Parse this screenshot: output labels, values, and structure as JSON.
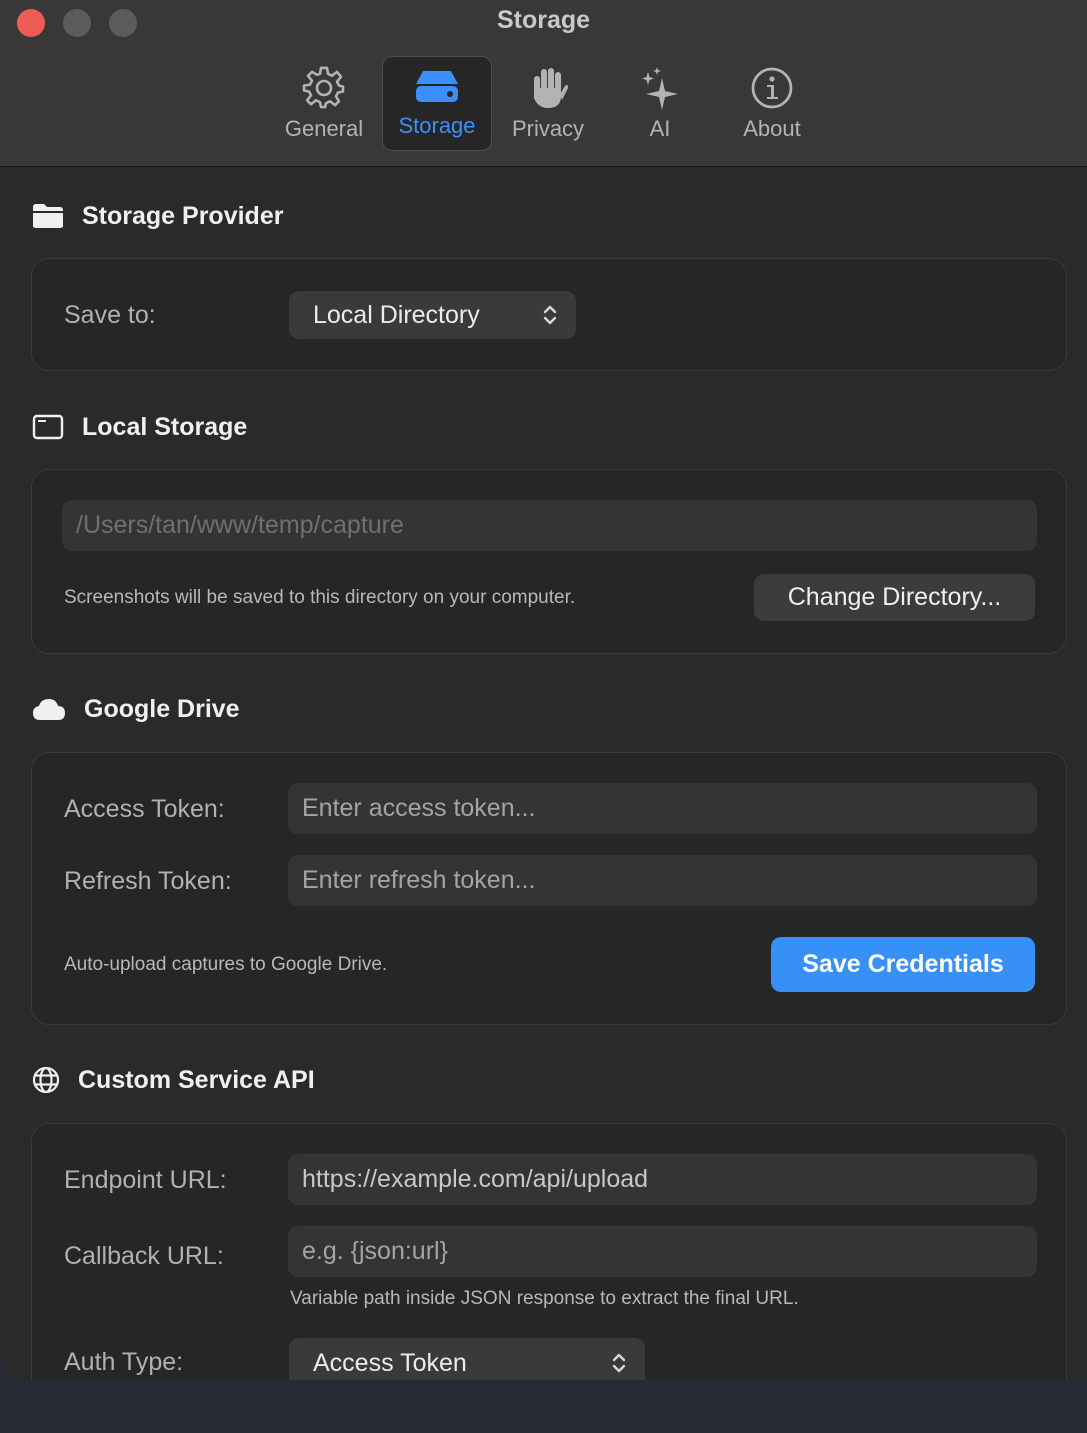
{
  "window": {
    "title": "Storage"
  },
  "tabs": [
    {
      "label": "General",
      "icon": "gear-icon"
    },
    {
      "label": "Storage",
      "icon": "drive-icon",
      "active": true
    },
    {
      "label": "Privacy",
      "icon": "hand-icon"
    },
    {
      "label": "AI",
      "icon": "sparkles-icon"
    },
    {
      "label": "About",
      "icon": "info-icon"
    }
  ],
  "storage_provider": {
    "heading": "Storage Provider",
    "save_to_label": "Save to:",
    "save_to_value": "Local Directory"
  },
  "local_storage": {
    "heading": "Local Storage",
    "path_placeholder": "/Users/tan/www/temp/capture",
    "description": "Screenshots will be saved to this directory on your computer.",
    "change_button": "Change Directory..."
  },
  "google_drive": {
    "heading": "Google Drive",
    "access_token_label": "Access Token:",
    "access_token_placeholder": "Enter access token...",
    "refresh_token_label": "Refresh Token:",
    "refresh_token_placeholder": "Enter refresh token...",
    "description": "Auto-upload captures to Google Drive.",
    "save_button": "Save Credentials"
  },
  "custom_api": {
    "heading": "Custom Service API",
    "endpoint_label": "Endpoint URL:",
    "endpoint_value": "https://example.com/api/upload",
    "callback_label": "Callback URL:",
    "callback_placeholder": "e.g. {json:url}",
    "callback_hint": "Variable path inside JSON response to extract the final URL.",
    "auth_type_label": "Auth Type:",
    "auth_type_value": "Access Token"
  },
  "colors": {
    "accent": "#3b8efb",
    "primary_button": "#3790f5",
    "close_button": "#ee5c55"
  }
}
